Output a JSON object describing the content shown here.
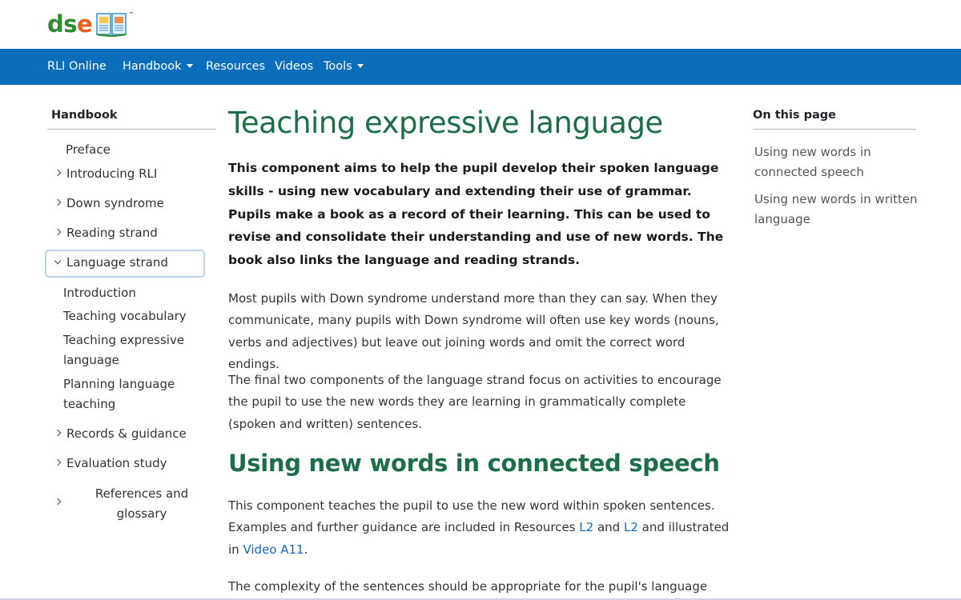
{
  "brand": {
    "logo_text_d": "d",
    "logo_text_s": "s",
    "logo_text_e": "e",
    "trademark": "™"
  },
  "nav": {
    "items": [
      {
        "label": "RLI Online"
      },
      {
        "label": "Handbook"
      },
      {
        "label": "Resources"
      },
      {
        "label": "Videos"
      },
      {
        "label": "Tools"
      }
    ]
  },
  "sidebar": {
    "title": "Handbook",
    "items": [
      {
        "label": "Preface"
      },
      {
        "label": "Introducing RLI"
      },
      {
        "label": "Down syndrome"
      },
      {
        "label": "Reading strand"
      },
      {
        "label": "Language strand"
      },
      {
        "label": "Records & guidance"
      },
      {
        "label": "Evaluation study"
      },
      {
        "label": "References and glossary"
      }
    ],
    "subitems": [
      {
        "label": "Introduction"
      },
      {
        "label": "Teaching vocabulary"
      },
      {
        "label": "Teaching expressive language"
      },
      {
        "label": "Planning language teaching"
      }
    ]
  },
  "main": {
    "title": "Teaching expressive language",
    "lead": "This component aims to help the pupil develop their spoken language skills - using new vocabulary and extending their use of grammar. Pupils make a book as a record of their learning. This can be used to revise and consolidate their understanding and use of new words. The book also links the language and reading strands.",
    "para1": "Most pupils with Down syndrome understand more than they can say. When they communicate, many pupils with Down syndrome will often use key words (nouns, verbs and adjectives) but leave out joining words and omit the correct word endings.",
    "para2": "The final two components of the language strand focus on activities to encourage the pupil to use the new words they are learning in grammatically complete (spoken and written) sentences.",
    "section_title": "Using new words in connected speech",
    "para3_a": "This component teaches the pupil to use the new word within spoken sentences. Examples and further guidance are included in Resources ",
    "para3_link1": "L2",
    "para3_b": " and ",
    "para3_link2": "L2",
    "para3_c": " and illustrated in ",
    "para3_link3": "Video A11",
    "para3_d": ".",
    "para4": "The complexity of the sentences should be appropriate for the pupil's language"
  },
  "toc": {
    "title": "On this page",
    "links": [
      {
        "label": "Using new words in connected speech"
      },
      {
        "label": "Using new words in written language"
      }
    ]
  },
  "colors": {
    "nav_bg": "#0a6ebd",
    "heading": "#1b6e48",
    "link": "#1467b8",
    "logo_green": "#2e8b2e",
    "logo_orange": "#e8601c"
  }
}
